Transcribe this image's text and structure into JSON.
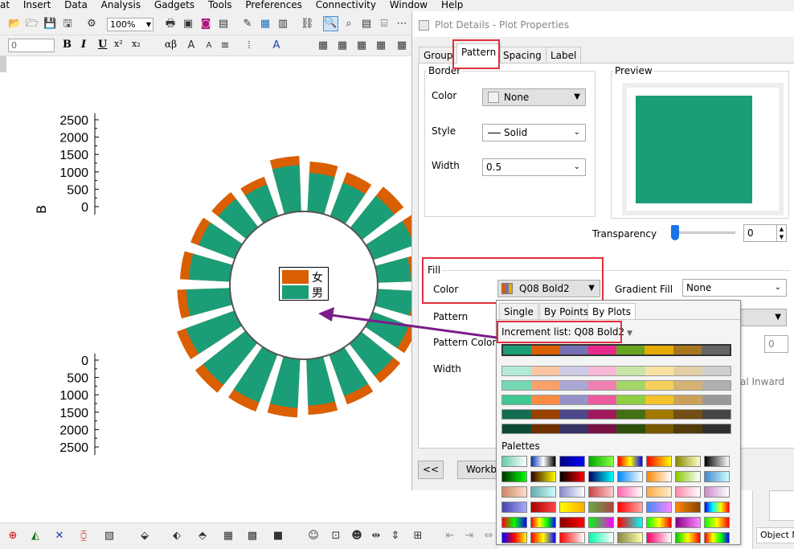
{
  "menu": [
    "at",
    "Insert",
    "Data",
    "Analysis",
    "Gadgets",
    "Tools",
    "Preferences",
    "Connectivity",
    "Window",
    "Help"
  ],
  "toolbar": {
    "zoom": "100%",
    "font_size": "0",
    "bold": "B",
    "italic": "I",
    "underline": "U",
    "superscript": "x²",
    "subscript": "x₂",
    "greek": "αβ"
  },
  "graph": {
    "y_axis_label": "B",
    "y_ticks_top": [
      "2500",
      "2000",
      "1500",
      "1000",
      "500",
      "0"
    ],
    "y_ticks_bottom": [
      "0",
      "500",
      "1000",
      "1500",
      "2000",
      "2500"
    ],
    "legend": [
      {
        "label": "女",
        "color": "#d95f02"
      },
      {
        "label": "男",
        "color": "#1b9e77"
      }
    ]
  },
  "dialog": {
    "title": "Plot Details - Plot Properties",
    "tabs": [
      "Group",
      "Pattern",
      "Spacing",
      "Label"
    ],
    "active_tab": "Pattern",
    "border": {
      "group_label": "Border",
      "color_label": "Color",
      "color_value": "None",
      "style_label": "Style",
      "style_value": "Solid",
      "width_label": "Width",
      "width_value": "0.5"
    },
    "preview": {
      "label": "Preview",
      "fill_color": "#1b9e77"
    },
    "transparency": {
      "label": "Transparency",
      "value": "0"
    },
    "fill": {
      "group_label": "Fill",
      "color_label": "Color",
      "color_value": "Q08 Bold2",
      "gradient_label": "Gradient Fill",
      "gradient_value": "None"
    },
    "pattern_label": "Pattern",
    "pattern_color_label": "Pattern Color",
    "width_label": "Width",
    "partial_value": "0",
    "partial_text": "al Inward",
    "back_button": "<<",
    "workbook_button": "Workb",
    "object_label": "Object M"
  },
  "popup": {
    "tabs": [
      "Single",
      "By Points",
      "By Plots"
    ],
    "active_tab": "By Plots",
    "increment_label": "Increment list: Q08 Bold2",
    "palettes_label": "Palettes",
    "selected_colors": [
      "#1b9e77",
      "#d95f02",
      "#7570b3",
      "#e7298a",
      "#66a61e",
      "#e6ab02",
      "#a6761d",
      "#666666"
    ],
    "shade_rows": [
      [
        "#b2ead7",
        "#fbc6a1",
        "#cdcbe5",
        "#f6b8d4",
        "#c8e6a8",
        "#f8e3a2",
        "#e3cfa6",
        "#cfcfcf"
      ],
      [
        "#76d9b3",
        "#f9a06b",
        "#aaa7d4",
        "#f07fb2",
        "#a4d66a",
        "#f5d05b",
        "#d5b372",
        "#b0b0b0"
      ],
      [
        "#40c892",
        "#f88a44",
        "#9793c8",
        "#ec5a9d",
        "#8fce40",
        "#f2c42b",
        "#cba15a",
        "#9a9a9a"
      ],
      [
        "#136d52",
        "#984101",
        "#4c488a",
        "#a2185c",
        "#437012",
        "#a27800",
        "#714f12",
        "#454545"
      ],
      [
        "#0c4a37",
        "#6e2f01",
        "#373466",
        "#7a1245",
        "#2f4f0c",
        "#785900",
        "#523a0d",
        "#2f2f2f"
      ]
    ]
  },
  "chart_data": {
    "type": "pie",
    "title": "",
    "series": [
      {
        "name": "女",
        "values": [
          1800,
          1700,
          1900,
          2000,
          1500,
          1600,
          1700,
          1800,
          1900,
          2000,
          2100,
          2200,
          2300,
          2200,
          1900,
          1800,
          1700,
          1600,
          1500,
          2000
        ]
      },
      {
        "name": "男",
        "values": [
          1500,
          1400,
          1600,
          1700,
          1300,
          1400,
          1500,
          1600,
          1700,
          1800,
          1900,
          2000,
          2100,
          2000,
          1700,
          1600,
          1500,
          1400,
          1300,
          1800
        ]
      }
    ],
    "ylim": [
      0,
      2500
    ],
    "colors": [
      "#d95f02",
      "#1b9e77"
    ]
  }
}
